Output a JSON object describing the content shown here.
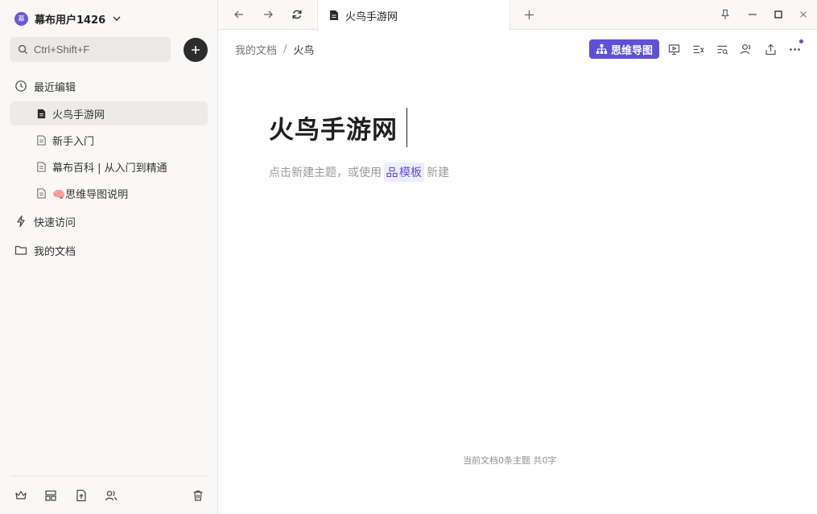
{
  "user": {
    "name": "幕布用户1426",
    "avatar_text": "幕"
  },
  "search": {
    "placeholder": "Ctrl+Shift+F"
  },
  "sidebar": {
    "recent_label": "最近编辑",
    "recent_docs": [
      "火鸟手游网",
      "新手入门",
      "幕布百科 | 从入门到精通",
      "🧠思维导图说明"
    ],
    "quick_access_label": "快速访问",
    "my_docs_label": "我的文档"
  },
  "tab": {
    "title": "火鸟手游网"
  },
  "breadcrumb": {
    "root": "我的文档",
    "separator": "/",
    "current": "火鸟"
  },
  "toolbar": {
    "mindmap_label": "思维导图"
  },
  "document": {
    "title": "火鸟手游网",
    "hint_before": "点击新建主题，或使用",
    "template_label": "模板",
    "hint_after": "新建"
  },
  "footer": {
    "stats": "当前文档0条主题 共0字"
  },
  "colors": {
    "accent": "#5b52d8",
    "sidebar_bg": "#f9f8f6"
  }
}
